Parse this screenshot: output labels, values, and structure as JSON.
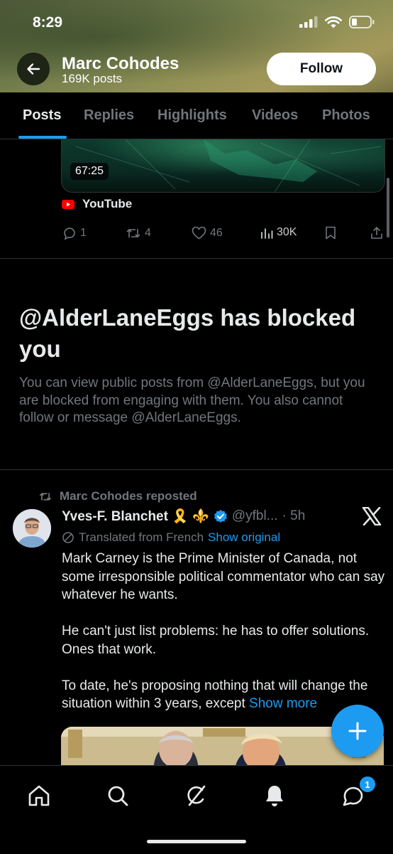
{
  "status_bar": {
    "time": "8:29"
  },
  "header": {
    "name": "Marc Cohodes",
    "posts_count": "169K posts",
    "follow_label": "Follow"
  },
  "tabs": [
    {
      "label": "Posts",
      "active": true
    },
    {
      "label": "Replies",
      "active": false
    },
    {
      "label": "Highlights",
      "active": false
    },
    {
      "label": "Videos",
      "active": false
    },
    {
      "label": "Photos",
      "active": false
    }
  ],
  "prev_post": {
    "video_duration": "67:25",
    "source": "YouTube",
    "actions": {
      "replies": "1",
      "reposts": "4",
      "likes": "46",
      "views": "30K"
    }
  },
  "blocked": {
    "title": "@AlderLaneEggs has blocked you",
    "message": "You can view public posts from @AlderLaneEggs, but you are blocked from engaging with them. You also cannot follow or message @AlderLaneEggs."
  },
  "repost": {
    "reposted_by": "Marc Cohodes reposted",
    "author_name": "Yves-F. Blanchet 🎗️ ⚜️",
    "handle": "@yfbl...",
    "time": "· 5h",
    "translated_label": "Translated from French",
    "show_original": "Show original",
    "paragraphs": [
      "Mark Carney is the Prime Minister of Canada, not some irresponsible political commentator who can say whatever he wants.",
      "He can't just list problems: he has to offer solutions. Ones that work.",
      "To date, he's proposing nothing that will change the situation within 3 years, except"
    ],
    "show_more": "Show more"
  },
  "bottom_nav": {
    "messages_badge": "1"
  },
  "colors": {
    "accent": "#1d9bf0",
    "background": "#000000",
    "muted": "#71767b",
    "text": "#e7e9ea"
  },
  "icons": [
    "back-arrow-icon",
    "signal-icon",
    "wifi-icon",
    "battery-icon",
    "youtube-icon",
    "reply-icon",
    "repost-icon",
    "like-icon",
    "views-icon",
    "bookmark-icon",
    "share-icon",
    "verified-icon",
    "translate-icon",
    "x-logo-icon",
    "plus-icon",
    "home-icon",
    "search-icon",
    "grok-icon",
    "notifications-icon",
    "messages-icon"
  ]
}
